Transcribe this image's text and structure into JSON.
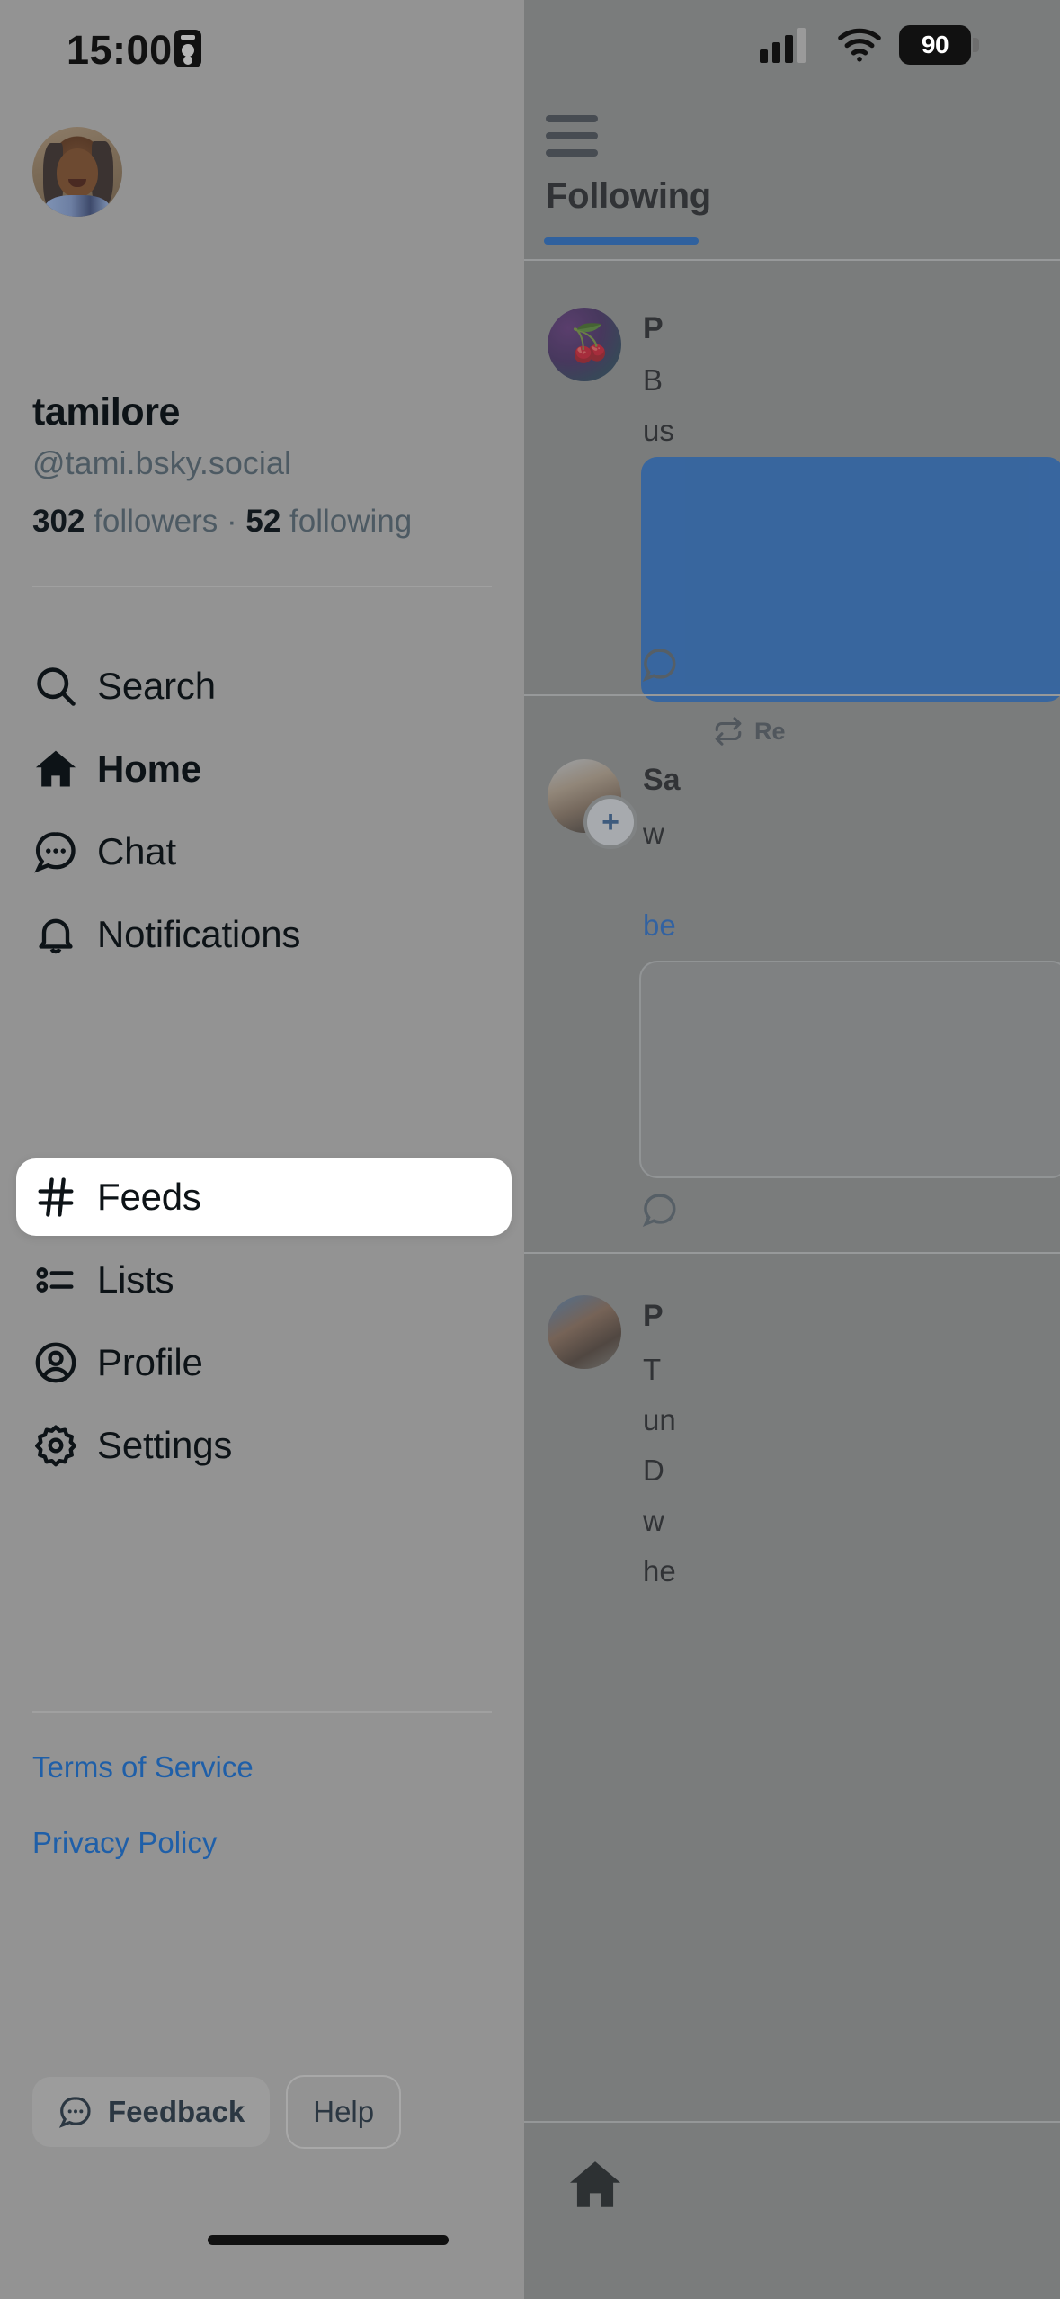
{
  "status_bar": {
    "time": "15:00",
    "id_icon": "id-card-icon",
    "signal_icon": "cellular-signal-icon",
    "wifi_icon": "wifi-icon",
    "battery_level": "90"
  },
  "drawer": {
    "avatar": "user-avatar",
    "display_name": "tamilore",
    "handle": "@tami.bsky.social",
    "stats": {
      "followers_count": "302",
      "followers_label": "followers",
      "separator": "·",
      "following_count": "52",
      "following_label": "following"
    },
    "nav_items": [
      {
        "label": "Search",
        "icon": "search-icon",
        "active": false
      },
      {
        "label": "Home",
        "icon": "home-icon",
        "active": true
      },
      {
        "label": "Chat",
        "icon": "chat-icon",
        "active": false
      },
      {
        "label": "Notifications",
        "icon": "bell-icon",
        "active": false
      },
      {
        "label": "Feeds",
        "icon": "hashtag-icon",
        "active": false,
        "highlighted": true
      },
      {
        "label": "Lists",
        "icon": "list-icon",
        "active": false
      },
      {
        "label": "Profile",
        "icon": "profile-circle-icon",
        "active": false
      },
      {
        "label": "Settings",
        "icon": "gear-icon",
        "active": false
      }
    ],
    "links": [
      {
        "label": "Terms of Service"
      },
      {
        "label": "Privacy Policy"
      }
    ],
    "footer_buttons": [
      {
        "label": "Feedback",
        "icon": "speech-bubble-icon",
        "style": "filled"
      },
      {
        "label": "Help",
        "icon": "",
        "style": "outline"
      }
    ]
  },
  "background_feed": {
    "menu_icon": "hamburger-menu-icon",
    "tabs": [
      {
        "label": "Following",
        "active": true
      }
    ],
    "posts": [
      {
        "author": "P",
        "avatar": "cherry-avatar",
        "lines": [
          "B",
          "us"
        ]
      },
      {
        "repost_label": "Re",
        "repost_icon": "repost-icon",
        "author": "Sa",
        "avatar": "person-avatar",
        "lines": [
          "w"
        ],
        "link_text": "be"
      },
      {
        "author": "P",
        "avatar": "person-avatar-2",
        "lines": [
          "T",
          "un",
          "D",
          "w",
          "he"
        ]
      }
    ],
    "scroll_to_top_icon": "chevron-up-icon",
    "bottom_nav": [
      {
        "icon": "home-icon",
        "active": true
      }
    ]
  },
  "colors": {
    "accent_blue": "#1266cf",
    "link_blue": "#1f5fa8",
    "text_primary": "#0d1317",
    "text_secondary": "#4d5a63",
    "drawer_bg": "#939393",
    "highlight_bg": "#ffffff"
  }
}
